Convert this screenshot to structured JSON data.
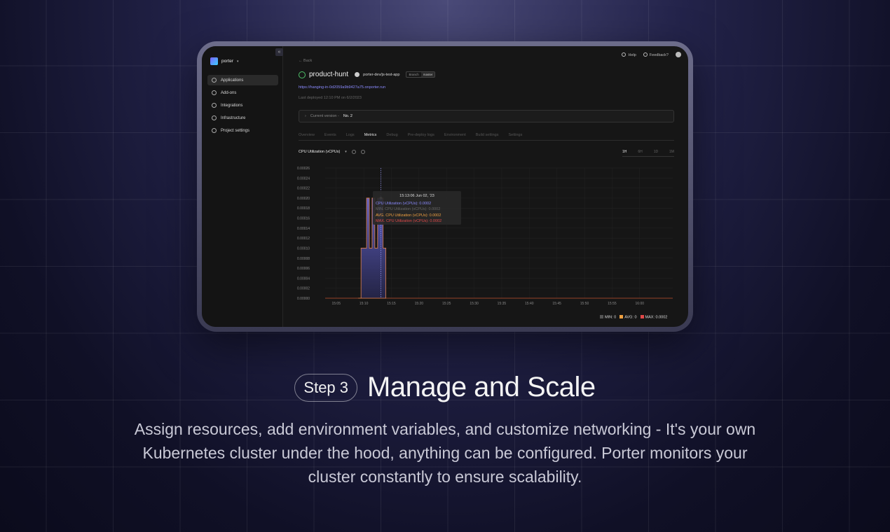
{
  "sidebar": {
    "brand": "porter",
    "collapse_icon": "«",
    "items": [
      {
        "label": "Applications",
        "icon": "globe-icon"
      },
      {
        "label": "Add-ons",
        "icon": "addons-icon"
      },
      {
        "label": "Integrations",
        "icon": "integrations-icon"
      },
      {
        "label": "Infrastructure",
        "icon": "database-icon"
      },
      {
        "label": "Project settings",
        "icon": "settings-icon"
      }
    ]
  },
  "topbar": {
    "help": "Help",
    "feedback": "Feedback?"
  },
  "app": {
    "back": "← Back",
    "title": "product-hunt",
    "repo": "porter-dev/js-test-app",
    "branch_label": "Branch",
    "branch_value": "master",
    "url": "https://hanging-in-0d2059a9b9427a75.onporter.run",
    "last_deployed": "Last deployed 12:10 PM on 6/2/2023",
    "version_label": "Current version -",
    "version_value": "No. 2"
  },
  "tabs": [
    "Overview",
    "Events",
    "Logs",
    "Metrics",
    "Debug",
    "Pre-deploy logs",
    "Environment",
    "Build settings",
    "Settings"
  ],
  "active_tab": "Metrics",
  "metric_selector": "CPU Utilization (vCPUs)",
  "range_tabs": [
    "1H",
    "6H",
    "1D",
    "1M"
  ],
  "active_range": "1H",
  "tooltip": {
    "time": "15:13:06 Jun 02, '23",
    "cpu": "CPU Utilization (vCPUs): 0.0002",
    "min": "MIN. CPU Utilization (vCPUs): 0.0002",
    "avg": "AVG. CPU Utilization (vCPUs): 0.0002",
    "max": "MAX. CPU Utilization (vCPUs): 0.0002"
  },
  "legend": {
    "min": "MIN: 0",
    "avg": "AVG: 0",
    "max": "MAX: 0.0002"
  },
  "colors": {
    "accent": "#8b8bff",
    "avg": "#f0a040",
    "max": "#e04848",
    "min": "#555555"
  },
  "chart_data": {
    "type": "area",
    "ylim": [
      0,
      0.00026
    ],
    "y_ticks": [
      "0.00026",
      "0.00024",
      "0.00022",
      "0.00020",
      "0.00018",
      "0.00016",
      "0.00014",
      "0.00012",
      "0.00010",
      "0.00008",
      "0.00006",
      "0.00004",
      "0.00002",
      "0.00000"
    ],
    "x_ticks": [
      "15:05",
      "15:10",
      "15:15",
      "15:20",
      "15:25",
      "15:30",
      "15:35",
      "15:40",
      "15:45",
      "15:50",
      "15:55",
      "16:00"
    ],
    "series": [
      {
        "name": "CPU Utilization (vCPUs)",
        "x": [
          "15:09",
          "15:09.5",
          "15:10",
          "15:10.5",
          "15:11",
          "15:11.5",
          "15:12",
          "15:12.5",
          "15:13",
          "15:13.5",
          "15:14"
        ],
        "values": [
          0,
          0.0001,
          0.0001,
          0.0002,
          0.0001,
          0.0002,
          0.0001,
          0.0002,
          0.0002,
          0.0001,
          0
        ]
      }
    ]
  },
  "footer": {
    "step": "Step 3",
    "headline": "Manage and Scale",
    "description": "Assign resources, add environment variables, and customize networking - It's your own Kubernetes cluster under the hood, anything can be configured. Porter monitors your cluster constantly to ensure scalability."
  }
}
